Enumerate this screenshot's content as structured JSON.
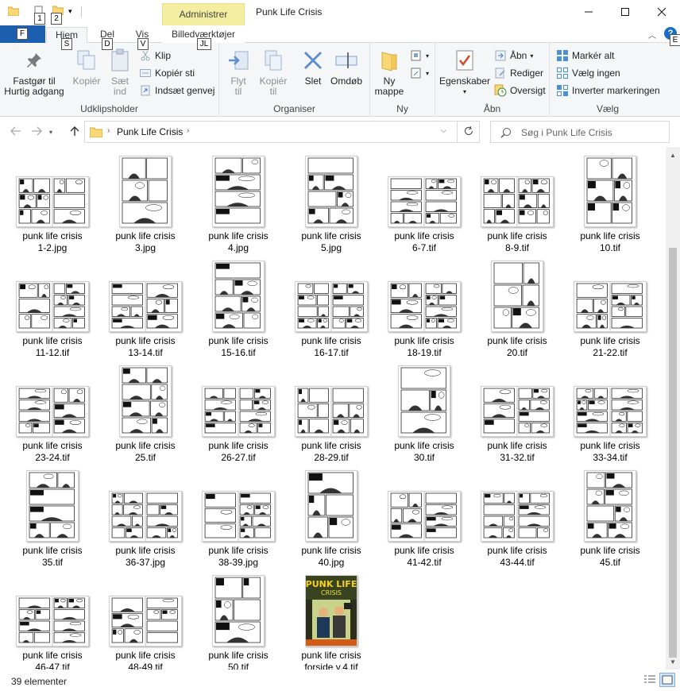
{
  "window": {
    "title": "Punk Life Crisis",
    "context_group": "Administrer",
    "context_tab": "Billedværktøjer"
  },
  "keytips": {
    "qa1": "1",
    "qa2": "2",
    "file": "F",
    "home": "S",
    "share": "D",
    "view": "V",
    "context": "JL",
    "help": "E"
  },
  "tabs": {
    "file": "Filer",
    "home": "Hjem",
    "share": "Del",
    "view": "Vis"
  },
  "ribbon": {
    "clipboard": {
      "label": "Udklipsholder",
      "pin": [
        "Fastgør til",
        "Hurtig adgang"
      ],
      "copy": "Kopiér",
      "paste": [
        "Sæt",
        "ind"
      ],
      "cut": "Klip",
      "copy_path": "Kopiér sti",
      "paste_shortcut": "Indsæt genvej"
    },
    "organize": {
      "label": "Organiser",
      "move": [
        "Flyt",
        "til"
      ],
      "copyto": [
        "Kopiér",
        "til"
      ],
      "delete": "Slet",
      "rename": "Omdøb"
    },
    "new": {
      "label": "Ny",
      "new_folder": [
        "Ny",
        "mappe"
      ]
    },
    "open": {
      "label": "Åbn",
      "properties": "Egenskaber",
      "open": "Åbn",
      "edit": "Rediger",
      "history": "Oversigt"
    },
    "select": {
      "label": "Vælg",
      "select_all": "Markér alt",
      "select_none": "Vælg ingen",
      "invert": "Inverter markeringen"
    }
  },
  "address": {
    "crumb": "Punk Life Crisis",
    "search_placeholder": "Søg i Punk Life Crisis"
  },
  "files": [
    {
      "l1": "punk life crisis",
      "l2": "1-2.jpg",
      "kind": "spread"
    },
    {
      "l1": "punk life crisis",
      "l2": "3.jpg",
      "kind": "page"
    },
    {
      "l1": "punk life crisis",
      "l2": "4.jpg",
      "kind": "page"
    },
    {
      "l1": "punk life crisis",
      "l2": "5.jpg",
      "kind": "page"
    },
    {
      "l1": "punk life crisis",
      "l2": "6-7.tif",
      "kind": "spread"
    },
    {
      "l1": "punk life crisis",
      "l2": "8-9.tif",
      "kind": "spread"
    },
    {
      "l1": "punk life crisis",
      "l2": "10.tif",
      "kind": "page"
    },
    {
      "l1": "punk life crisis",
      "l2": "11-12.tif",
      "kind": "spread"
    },
    {
      "l1": "punk life crisis",
      "l2": "13-14.tif",
      "kind": "spread"
    },
    {
      "l1": "punk life crisis",
      "l2": "15-16.tif",
      "kind": "page"
    },
    {
      "l1": "punk life crisis",
      "l2": "16-17.tif",
      "kind": "spread"
    },
    {
      "l1": "punk life crisis",
      "l2": "18-19.tif",
      "kind": "spread"
    },
    {
      "l1": "punk life crisis",
      "l2": "20.tif",
      "kind": "page"
    },
    {
      "l1": "punk life crisis",
      "l2": "21-22.tif",
      "kind": "spread"
    },
    {
      "l1": "punk life crisis",
      "l2": "23-24.tif",
      "kind": "spread"
    },
    {
      "l1": "punk life crisis",
      "l2": "25.tif",
      "kind": "page"
    },
    {
      "l1": "punk life crisis",
      "l2": "26-27.tif",
      "kind": "spread"
    },
    {
      "l1": "punk life crisis",
      "l2": "28-29.tif",
      "kind": "spread"
    },
    {
      "l1": "punk life crisis",
      "l2": "30.tif",
      "kind": "page"
    },
    {
      "l1": "punk life crisis",
      "l2": "31-32.tif",
      "kind": "spread"
    },
    {
      "l1": "punk life crisis",
      "l2": "33-34.tif",
      "kind": "spread"
    },
    {
      "l1": "punk life crisis",
      "l2": "35.tif",
      "kind": "page"
    },
    {
      "l1": "punk life crisis",
      "l2": "36-37.jpg",
      "kind": "spread"
    },
    {
      "l1": "punk life crisis",
      "l2": "38-39.jpg",
      "kind": "spread"
    },
    {
      "l1": "punk life crisis",
      "l2": "40.jpg",
      "kind": "page"
    },
    {
      "l1": "punk life crisis",
      "l2": "41-42.tif",
      "kind": "spread"
    },
    {
      "l1": "punk life crisis",
      "l2": "43-44.tif",
      "kind": "spread"
    },
    {
      "l1": "punk life crisis",
      "l2": "45.tif",
      "kind": "page"
    },
    {
      "l1": "punk life crisis",
      "l2": "46-47.tif",
      "kind": "spread"
    },
    {
      "l1": "punk life crisis",
      "l2": "48-49.tif",
      "kind": "spread"
    },
    {
      "l1": "punk life crisis",
      "l2": "50.tif",
      "kind": "page"
    },
    {
      "l1": "punk life crisis",
      "l2": "forside v.4.tif",
      "kind": "cover"
    }
  ],
  "status": {
    "count": "39 elementer"
  },
  "colors": {
    "accent": "#1b5fae",
    "context_tab": "#f4efa0",
    "folder": "#f8d775"
  }
}
